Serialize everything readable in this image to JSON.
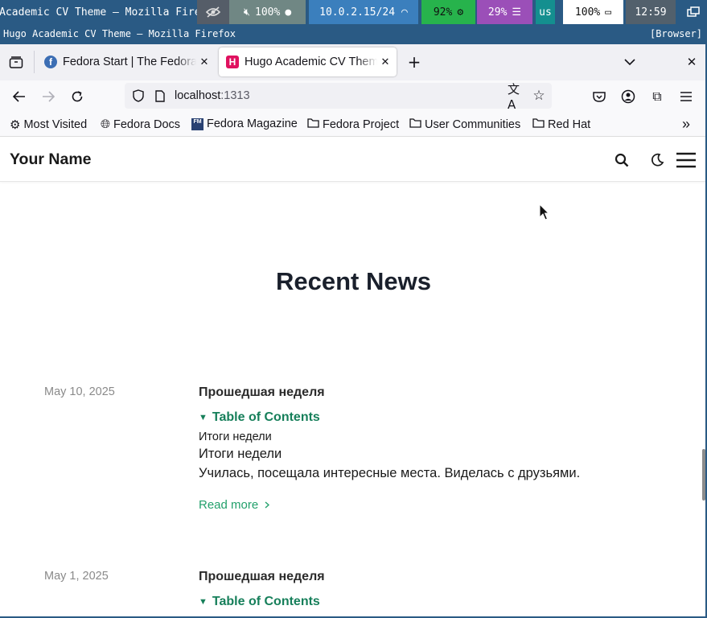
{
  "status_bar": {
    "window_title": "Hugo Academic CV Theme — Mozilla Firefox",
    "volume": "100%",
    "network": "10.0.2.15/24",
    "cpu": "92%",
    "memory": "29%",
    "keyboard_layout": "us",
    "brightness": "100%",
    "clock": "12:59"
  },
  "title_bar": {
    "title": "Hugo Academic CV Theme — Mozilla Firefox",
    "tag": "[Browser]"
  },
  "tabs": [
    {
      "label": "Fedora Start | The Fedora Project",
      "active": false
    },
    {
      "label": "Hugo Academic CV Theme",
      "active": true,
      "favicon_letter": "H"
    }
  ],
  "url": {
    "host": "localhost",
    "port": ":1313"
  },
  "bookmarks": [
    {
      "label": "Most Visited",
      "icon": "gear-icon"
    },
    {
      "label": "Fedora Docs",
      "icon": "globe-icon"
    },
    {
      "label": "Fedora Magazine",
      "icon": "fm-icon"
    },
    {
      "label": "Fedora Project",
      "icon": "folder-icon"
    },
    {
      "label": "User Communities",
      "icon": "folder-icon"
    },
    {
      "label": "Red Hat",
      "icon": "folder-icon"
    }
  ],
  "site": {
    "brand": "Your Name",
    "section_title": "Recent News"
  },
  "posts": [
    {
      "date": "May 10, 2025",
      "title": "Прошедшая неделя",
      "toc_label": "Table of Contents",
      "toc_item": "Итоги недели",
      "heading": "Итоги недели",
      "summary": "Училась, посещала интересные места. Виделась с друзьями.",
      "read_more": "Read more"
    },
    {
      "date": "May 1, 2025",
      "title": "Прошедшая неделя",
      "toc_label": "Table of Contents"
    }
  ],
  "colors": {
    "accent_green": "#22a06b",
    "toc_green": "#167f5a",
    "statusbar_blue": "#2a5a84"
  }
}
